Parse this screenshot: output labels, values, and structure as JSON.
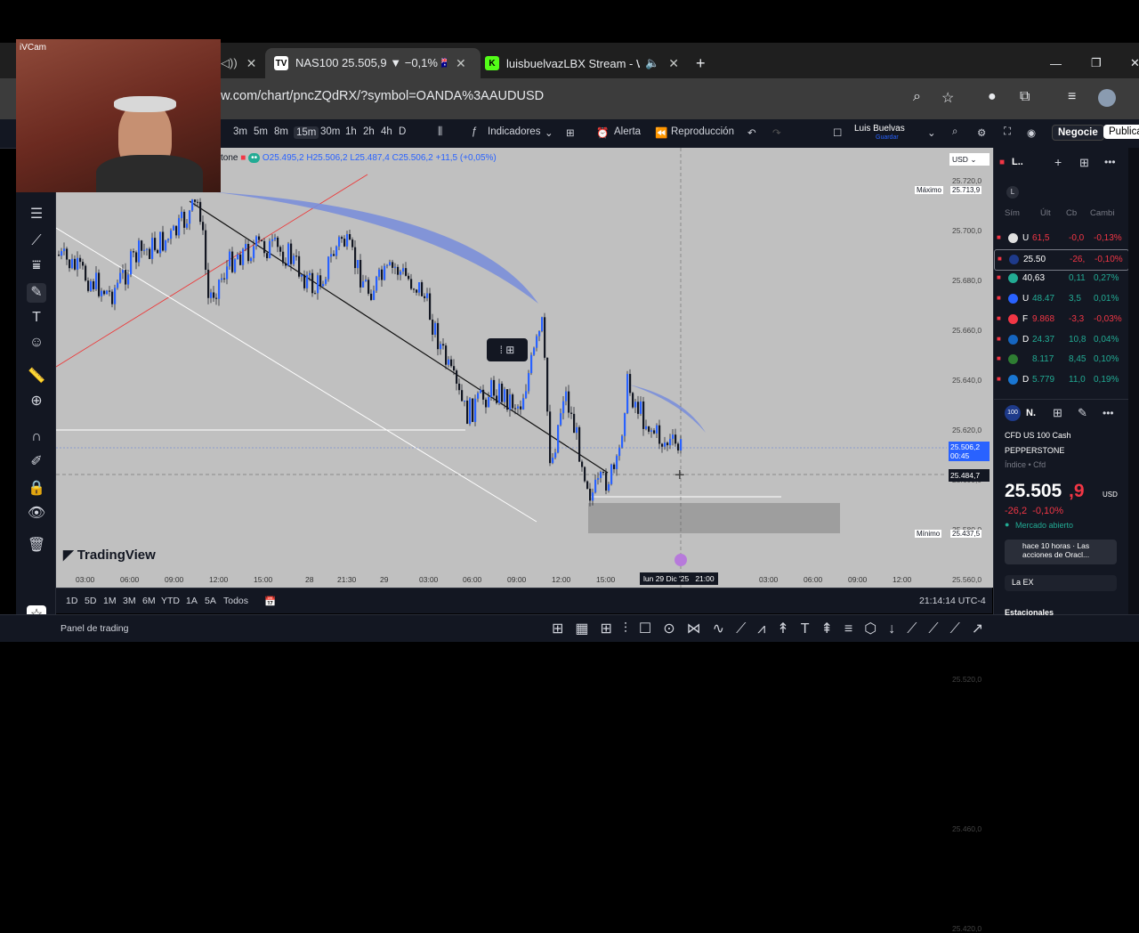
{
  "browser": {
    "tabs": [
      {
        "label": "NAS100 25.505,9 ▼ −0,1% 🇦🇺",
        "icon": "tradingview-icon",
        "active": true
      },
      {
        "label": "luisbuelvazLBX Stream - Wa",
        "icon": "kick-icon",
        "active": false
      }
    ],
    "url": "ew.com/chart/pncZQdRX/?symbol=OANDA%3AAUDUSD",
    "webcam_label": "iVCam"
  },
  "toolbar": {
    "timeframes": [
      "3m",
      "5m",
      "8m",
      "15m",
      "30m",
      "1h",
      "2h",
      "4h",
      "D"
    ],
    "active_timeframe": "15m",
    "indicators": "Indicadores",
    "alert": "Alerta",
    "replay": "Reproducción",
    "user": "Luis Buelvas",
    "user_sub": "Guardar",
    "trade": "Negocie",
    "publish": "Publica"
  },
  "legend": {
    "symbol": "tone",
    "o": "O25.495,2",
    "h": "H25.506,2",
    "l": "L25.487,4",
    "c": "C25.506,2",
    "chg": "+11,5 (+0,05%)"
  },
  "price_axis": {
    "currency": "USD",
    "labels": [
      "25.720,0",
      "25.700,0",
      "25.680,0",
      "25.660,0",
      "25.640,0",
      "25.620,0",
      "25.600,0",
      "25.580,0",
      "25.560,0",
      "25.540,0",
      "25.520,0",
      "25.460,0",
      "25.420,0"
    ],
    "max_label": "Máximo",
    "max_value": "25.713,9",
    "min_label": "Mínimo",
    "min_value": "25.437,5",
    "current_price": "25.506,2",
    "countdown": "00:45",
    "crosshair_price": "25.484,7"
  },
  "time_axis": {
    "labels": [
      "03:00",
      "06:00",
      "09:00",
      "12:00",
      "15:00",
      "28",
      "21:30",
      "29",
      "03:00",
      "06:00",
      "09:00",
      "12:00",
      "15:00",
      "03:00",
      "06:00",
      "09:00",
      "12:00"
    ],
    "crosshair_time": "lun 29 Dic '25   21:00"
  },
  "watermark": "TradingView",
  "bottom": {
    "ranges": [
      "1D",
      "5D",
      "1M",
      "3M",
      "6M",
      "YTD",
      "1A",
      "5A",
      "Todos"
    ],
    "clock": "21:14:14 UTC-4",
    "panel": "Panel de trading"
  },
  "watchlist": {
    "title": "L..",
    "headers": [
      "Sím",
      "Últ",
      "Cb",
      "Cambi"
    ],
    "rows": [
      {
        "sym": "U",
        "last": "61,5",
        "chg": "-0,0",
        "pct": "-0,13%",
        "dir": "down"
      },
      {
        "sym": "25.50",
        "last": "",
        "chg": "-26,",
        "pct": "-0,10%",
        "dir": "down"
      },
      {
        "sym": "40,63",
        "last": "",
        "chg": "0,11",
        "pct": "0,27%",
        "dir": "up"
      },
      {
        "sym": "U",
        "last": "48.47",
        "chg": "3,5",
        "pct": "0,01%",
        "dir": "up"
      },
      {
        "sym": "F",
        "last": "9.868",
        "chg": "-3,3",
        "pct": "-0,03%",
        "dir": "down"
      },
      {
        "sym": "D",
        "last": "24.37",
        "chg": "10,8",
        "pct": "0,04%",
        "dir": "up"
      },
      {
        "sym": "",
        "last": "8.117",
        "chg": "8,45",
        "pct": "0,10%",
        "dir": "up"
      },
      {
        "sym": "D",
        "last": "5.779",
        "chg": "11,0",
        "pct": "0,19%",
        "dir": "up"
      }
    ]
  },
  "details": {
    "short": "N.",
    "name": "CFD US 100 Cash",
    "broker": "PEPPERSTONE",
    "type": "Índice • Cfd",
    "price_main": "25.505",
    "price_dec": ",9",
    "currency": "USD",
    "change": "-26,2  -0,10%",
    "status": "Mercado abierto",
    "news": "hace 10 horas · Las acciones de Oracl...",
    "ex": "La EX",
    "seasonal": "Estacionales"
  },
  "colors": {
    "up": "#2962ff",
    "down": "#131722",
    "bg": "#c0c0c0"
  }
}
